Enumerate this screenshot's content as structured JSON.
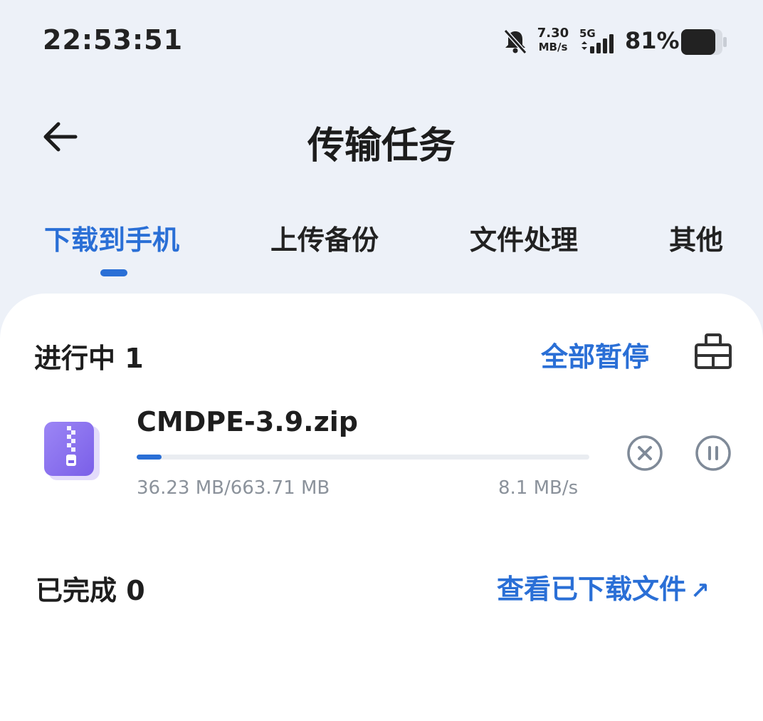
{
  "status_bar": {
    "time": "22:53:51",
    "net_speed_value": "7.30",
    "net_speed_unit": "MB/s",
    "network_type": "5G",
    "battery_percent": "81%",
    "icons": [
      "bell-muted-icon",
      "signal-icon",
      "battery-icon"
    ]
  },
  "header": {
    "title": "传输任务",
    "back_icon": "arrow-left-icon"
  },
  "tabs": [
    {
      "label": "下载到手机",
      "active": true
    },
    {
      "label": "上传备份",
      "active": false
    },
    {
      "label": "文件处理",
      "active": false
    },
    {
      "label": "其他",
      "active": false
    }
  ],
  "sections": {
    "in_progress_label": "进行中 1",
    "pause_all_label": "全部暂停",
    "clear_icon": "clear-icon",
    "completed_label": "已完成 0",
    "view_downloaded_label": "查看已下载文件",
    "view_downloaded_arrow": "↗"
  },
  "task": {
    "file_name": "CMDPE-3.9.zip",
    "file_icon": "zip-file-icon",
    "size_text": "36.23 MB/663.71 MB",
    "speed_text": "8.1 MB/s",
    "progress_fraction": 0.0546,
    "cancel_icon": "cancel-icon",
    "pause_icon": "pause-icon"
  },
  "colors": {
    "accent": "#2a6fd6",
    "background": "#edf1f8",
    "card": "#ffffff",
    "muted_text": "#8b929b",
    "file_icon": "#8a6cf0"
  }
}
